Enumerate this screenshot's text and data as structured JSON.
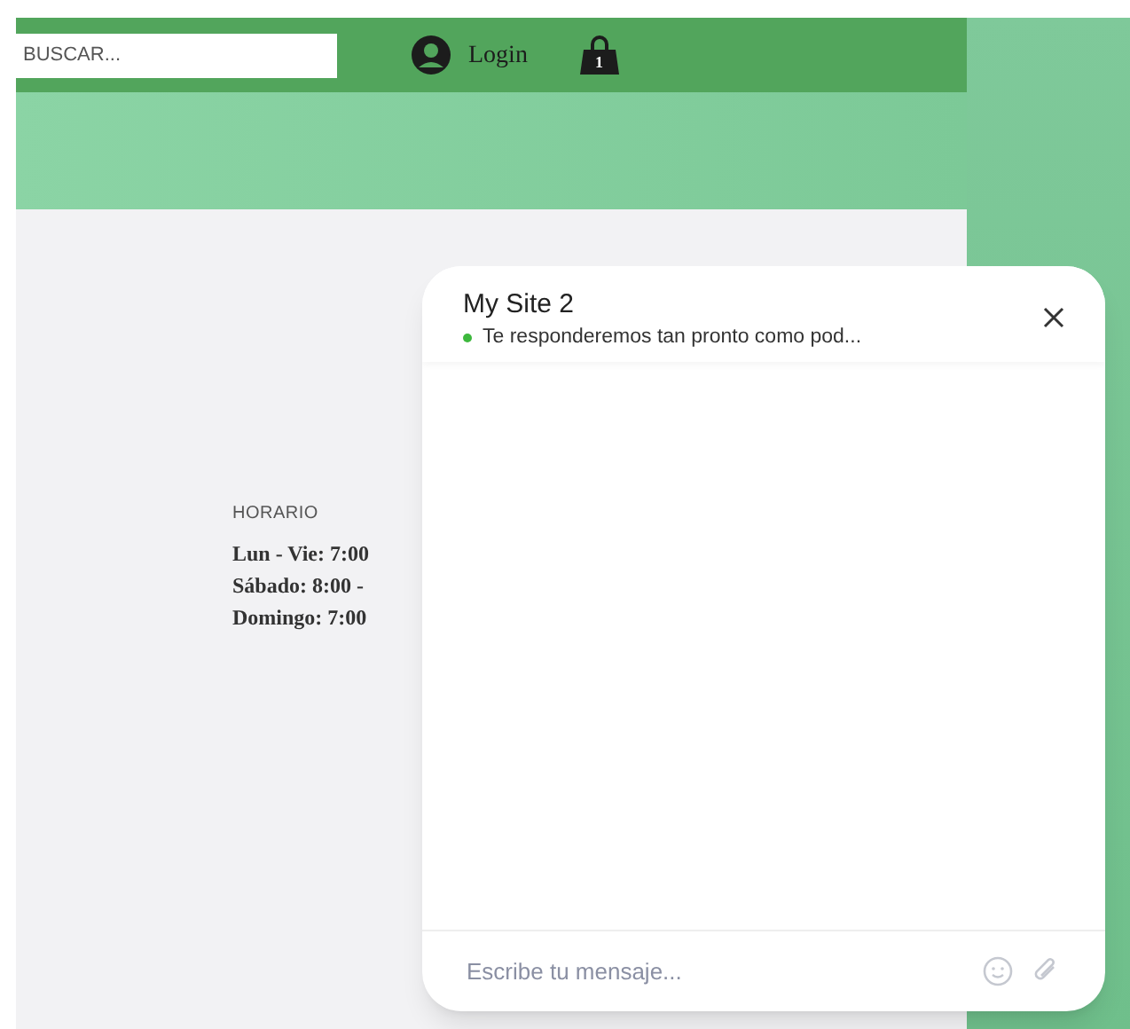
{
  "header": {
    "search": {
      "placeholder": "BUSCAR..."
    },
    "login": "Login",
    "cart_count": "1"
  },
  "hours": {
    "title": "HORARIO",
    "lines": [
      "Lun - Vie: 7:00",
      "Sábado: 8:00 -",
      "Domingo: 7:00"
    ]
  },
  "chat": {
    "title": "My Site 2",
    "online": true,
    "status": "Te responderemos tan pronto como pod...",
    "input": {
      "placeholder": "Escribe tu mensaje..."
    }
  }
}
